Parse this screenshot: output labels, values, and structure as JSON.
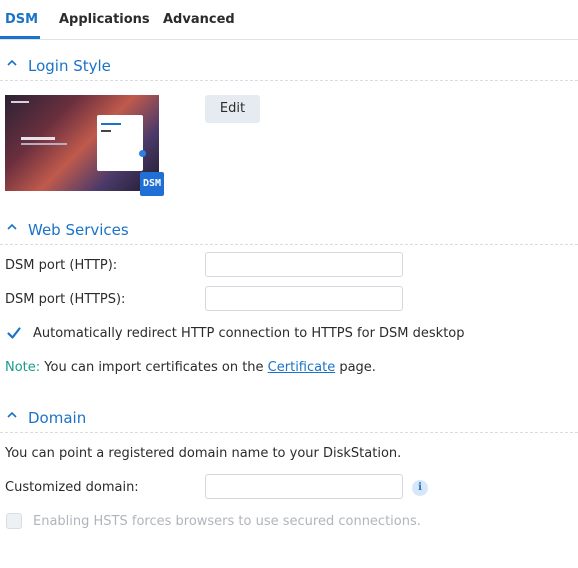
{
  "tabs": [
    {
      "label": "DSM",
      "active": true
    },
    {
      "label": "Applications",
      "active": false
    },
    {
      "label": "Advanced",
      "active": false
    }
  ],
  "login_style": {
    "title": "Login Style",
    "badge_text": "DSM",
    "edit_label": "Edit"
  },
  "web_services": {
    "title": "Web Services",
    "http_label": "DSM port (HTTP):",
    "http_value": "",
    "https_label": "DSM port (HTTPS):",
    "https_value": "",
    "redirect_label": "Automatically redirect HTTP connection to HTTPS for DSM desktop",
    "redirect_checked": true,
    "note_label": "Note:",
    "note_text_before": " You can import certificates on the ",
    "note_link": "Certificate",
    "note_text_after": " page."
  },
  "domain": {
    "title": "Domain",
    "description": "You can point a registered domain name to your DiskStation.",
    "custom_label": "Customized domain:",
    "custom_value": "",
    "info_icon_glyph": "i",
    "hsts_label": "Enabling HSTS forces browsers to use secured connections.",
    "hsts_checked": false,
    "hsts_disabled": true
  },
  "colors": {
    "accent": "#1a73c8",
    "note": "#1a9c8c",
    "badge": "#1f6fd6"
  },
  "icons": {
    "section_toggle": "chevron-up-icon",
    "checkbox": "checkmark-icon",
    "info": "info-icon"
  }
}
